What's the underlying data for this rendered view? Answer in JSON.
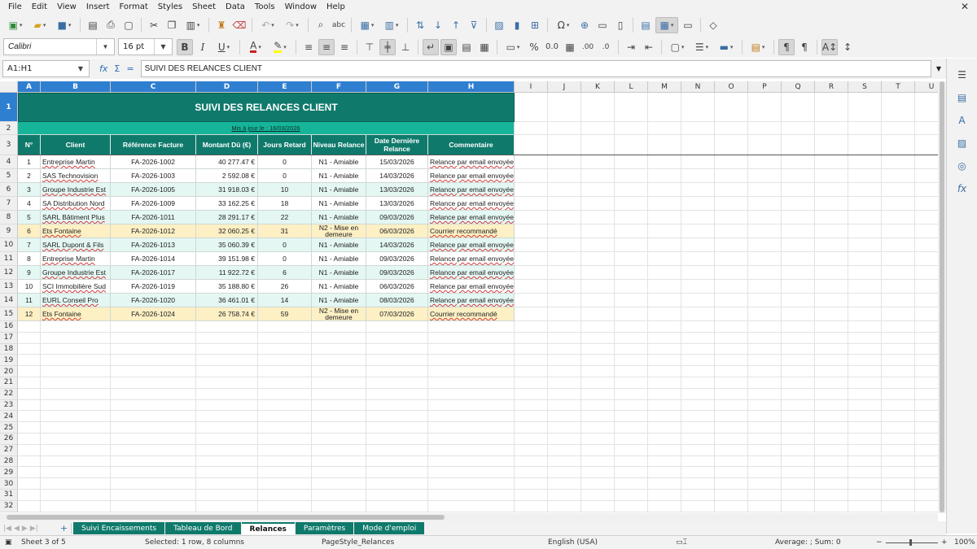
{
  "menu": [
    "File",
    "Edit",
    "View",
    "Insert",
    "Format",
    "Styles",
    "Sheet",
    "Data",
    "Tools",
    "Window",
    "Help"
  ],
  "toolbar": {
    "font_name": "Calibri",
    "font_size": "16 pt",
    "bold": "B",
    "italic": "I",
    "underline": "U"
  },
  "formula": {
    "cell_ref": "A1:H1",
    "content": "SUIVI DES RELANCES CLIENT",
    "fx": "fx",
    "sigma": "Σ",
    "equals": "="
  },
  "columns": [
    "A",
    "B",
    "C",
    "D",
    "E",
    "F",
    "G",
    "H",
    "I",
    "J",
    "K",
    "L",
    "M",
    "N",
    "O",
    "P",
    "Q",
    "R",
    "S",
    "T",
    "U"
  ],
  "sheet": {
    "title": "SUIVI DES RELANCES CLIENT",
    "subtitle": "Mis à jour le : 16/03/2026",
    "headers": [
      "N°",
      "Client",
      "Référence Facture",
      "Montant Dû (€)",
      "Jours Retard",
      "Niveau Relance",
      "Date Dernière Relance",
      "Commentaire"
    ],
    "rows": [
      [
        "1",
        "Entreprise Martin",
        "FA-2026-1002",
        "40 277.47 €",
        "0",
        "N1 - Amiable",
        "15/03/2026",
        "Relance par email envoyée"
      ],
      [
        "2",
        "SAS Technovision",
        "FA-2026-1003",
        "2 592.08 €",
        "0",
        "N1 - Amiable",
        "14/03/2026",
        "Relance par email envoyée"
      ],
      [
        "3",
        "Groupe Industrie Est",
        "FA-2026-1005",
        "31 918.03 €",
        "10",
        "N1 - Amiable",
        "13/03/2026",
        "Relance par email envoyée"
      ],
      [
        "4",
        "SA Distribution Nord",
        "FA-2026-1009",
        "33 162.25 €",
        "18",
        "N1 - Amiable",
        "13/03/2026",
        "Relance par email envoyée"
      ],
      [
        "5",
        "SARL Bâtiment Plus",
        "FA-2026-1011",
        "28 291.17 €",
        "22",
        "N1 - Amiable",
        "09/03/2026",
        "Relance par email envoyée"
      ],
      [
        "6",
        "Ets Fontaine",
        "FA-2026-1012",
        "32 060.25 €",
        "31",
        "N2 - Mise en demeure",
        "06/03/2026",
        "Courrier recommandé"
      ],
      [
        "7",
        "SARL Dupont & Fils",
        "FA-2026-1013",
        "35 060.39 €",
        "0",
        "N1 - Amiable",
        "14/03/2026",
        "Relance par email envoyée"
      ],
      [
        "8",
        "Entreprise Martin",
        "FA-2026-1014",
        "39 151.98 €",
        "0",
        "N1 - Amiable",
        "09/03/2026",
        "Relance par email envoyée"
      ],
      [
        "9",
        "Groupe Industrie Est",
        "FA-2026-1017",
        "11 922.72 €",
        "6",
        "N1 - Amiable",
        "09/03/2026",
        "Relance par email envoyée"
      ],
      [
        "10",
        "SCI Immobilière Sud",
        "FA-2026-1019",
        "35 188.80 €",
        "26",
        "N1 - Amiable",
        "06/03/2026",
        "Relance par email envoyée"
      ],
      [
        "11",
        "EURL Conseil Pro",
        "FA-2026-1020",
        "36 461.01 €",
        "14",
        "N1 - Amiable",
        "08/03/2026",
        "Relance par email envoyée"
      ],
      [
        "12",
        "Ets Fontaine",
        "FA-2026-1024",
        "26 758.74 €",
        "59",
        "N2 - Mise en demeure",
        "07/03/2026",
        "Courrier recommandé"
      ]
    ],
    "row_styles": [
      "ra",
      "ra",
      "rb",
      "ra",
      "rb",
      "ry",
      "rb",
      "ra",
      "rb",
      "ra",
      "rb",
      "ry"
    ],
    "row_numbers": [
      "1",
      "2",
      "3",
      "4",
      "5",
      "6",
      "7",
      "8",
      "9",
      "10",
      "11",
      "12",
      "13",
      "14",
      "15",
      "16",
      "17",
      "18",
      "19",
      "20",
      "21",
      "22",
      "23",
      "24",
      "25",
      "26",
      "27",
      "28",
      "29",
      "30",
      "31",
      "32"
    ]
  },
  "tabs": [
    "Suivi Encaissements",
    "Tableau de Bord",
    "Relances",
    "Paramètres",
    "Mode d'emploi"
  ],
  "active_tab": "Relances",
  "status": {
    "sheet": "Sheet 3 of 5",
    "selection": "Selected: 1 row, 8 columns",
    "page_style": "PageStyle_Relances",
    "language": "English (USA)",
    "sum": "Average: ; Sum: 0",
    "zoom": "100%"
  },
  "colors": {
    "header_teal": "#0f7a6c",
    "subtitle_teal": "#16b59a",
    "selection_blue": "#2f7fd1",
    "highlight_yellow": "#fdf0c4"
  }
}
